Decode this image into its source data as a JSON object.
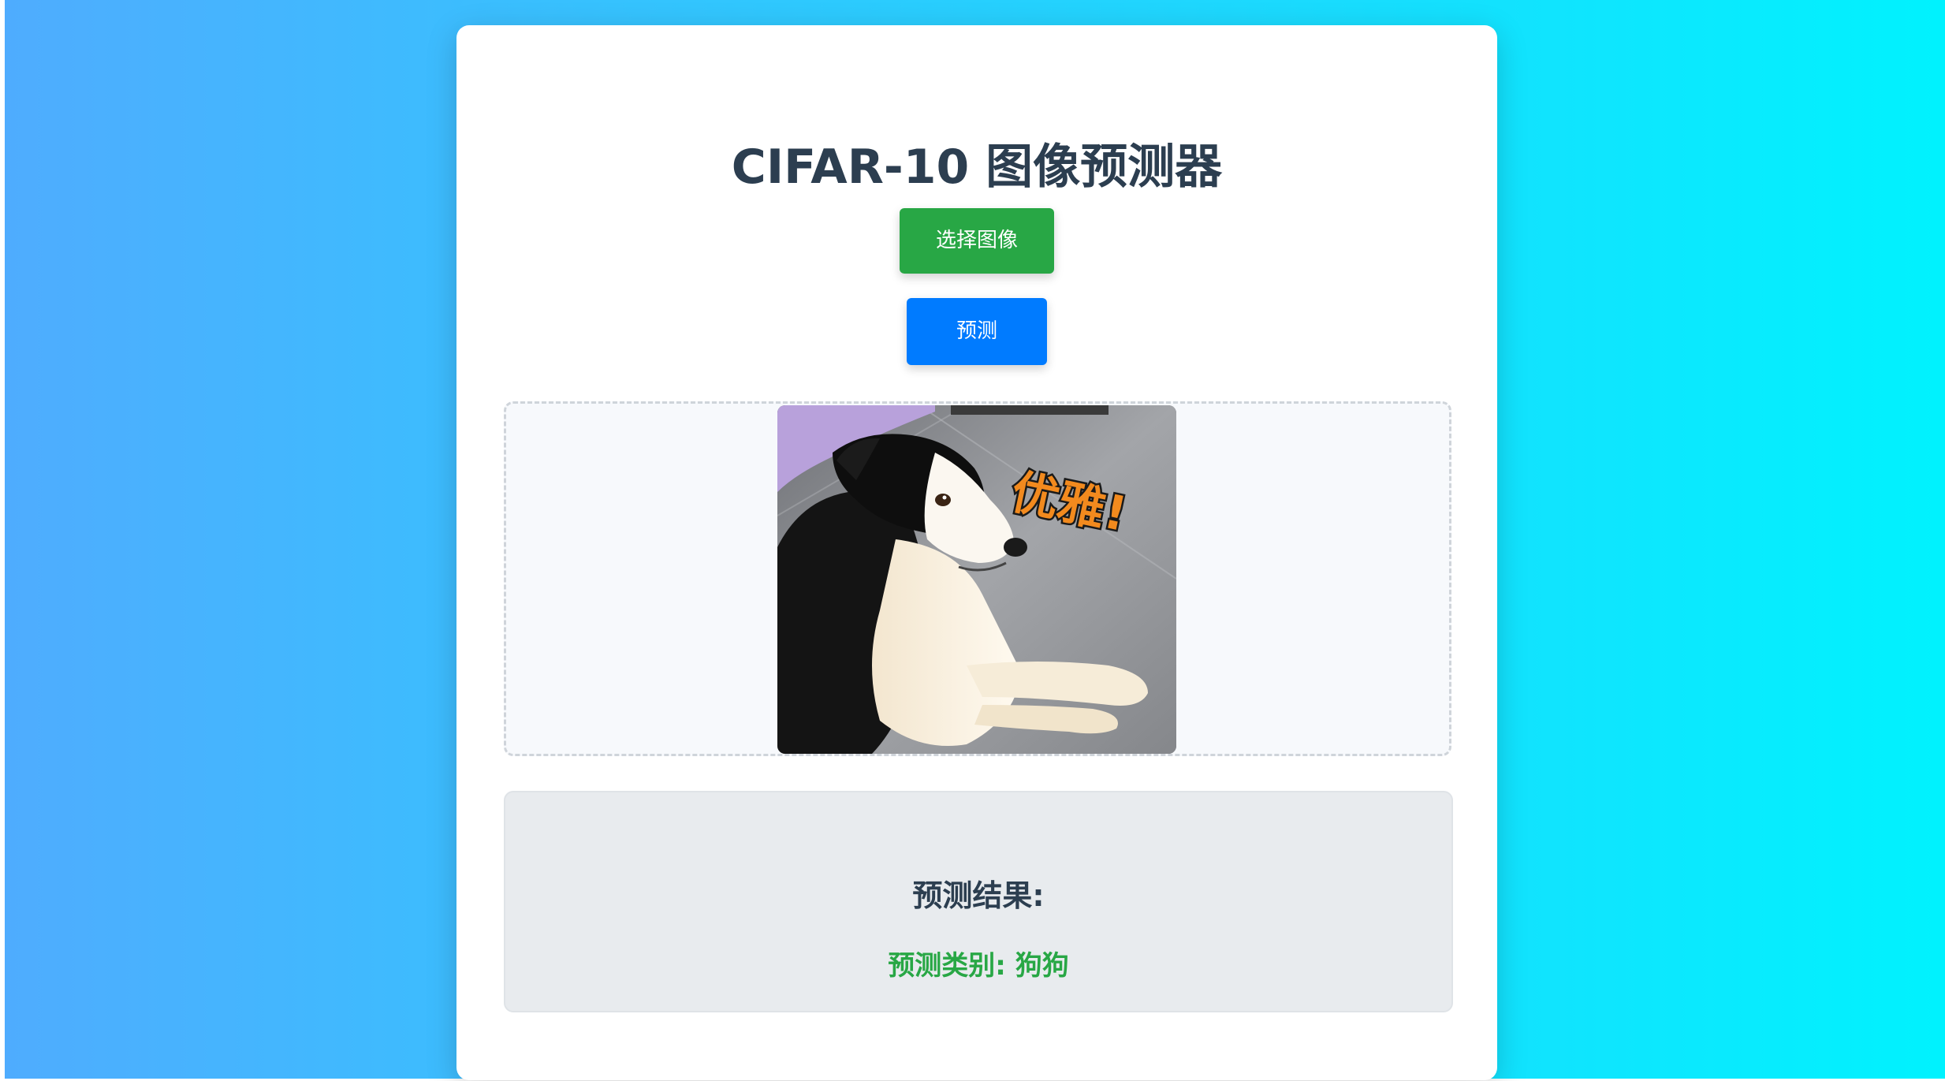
{
  "app": {
    "title": "CIFAR-10 图像预测器"
  },
  "buttons": {
    "select_label": "选择图像",
    "predict_label": "预测"
  },
  "preview": {
    "image_caption": "优雅!"
  },
  "result": {
    "heading": "预测结果:",
    "value": "预测类别: 狗狗"
  },
  "colors": {
    "background_start": "#4facfe",
    "background_end": "#00f2fe",
    "select_button": "#28a745",
    "predict_button": "#007bff",
    "result_text": "#28a745",
    "title_text": "#2c3e50"
  }
}
